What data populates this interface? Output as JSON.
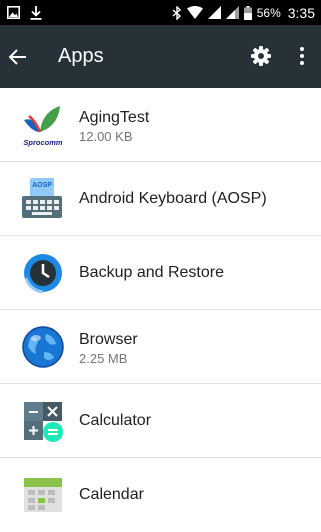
{
  "status_bar": {
    "battery_percent": "56%",
    "time": "3:35",
    "icons": [
      "image-icon",
      "download-icon",
      "bluetooth-icon",
      "wifi-icon",
      "signal-icon",
      "signal-icon",
      "battery-icon"
    ]
  },
  "app_bar": {
    "title": "Apps",
    "back_icon": "arrow-left-icon",
    "settings_icon": "gear-icon",
    "overflow_icon": "more-vert-icon",
    "background": "#263238"
  },
  "apps": [
    {
      "name": "AgingTest",
      "size": "12.00 KB",
      "icon": "sprocomm-logo-icon",
      "logo_text": "Sprocomm"
    },
    {
      "name": "Android Keyboard (AOSP)",
      "size": "",
      "icon": "keyboard-icon",
      "logo_text": "AOSP"
    },
    {
      "name": "Backup and Restore",
      "size": "",
      "icon": "backup-restore-icon"
    },
    {
      "name": "Browser",
      "size": "2.25 MB",
      "icon": "globe-icon"
    },
    {
      "name": "Calculator",
      "size": "",
      "icon": "calculator-icon"
    },
    {
      "name": "Calendar",
      "size": "",
      "icon": "calendar-icon"
    }
  ]
}
